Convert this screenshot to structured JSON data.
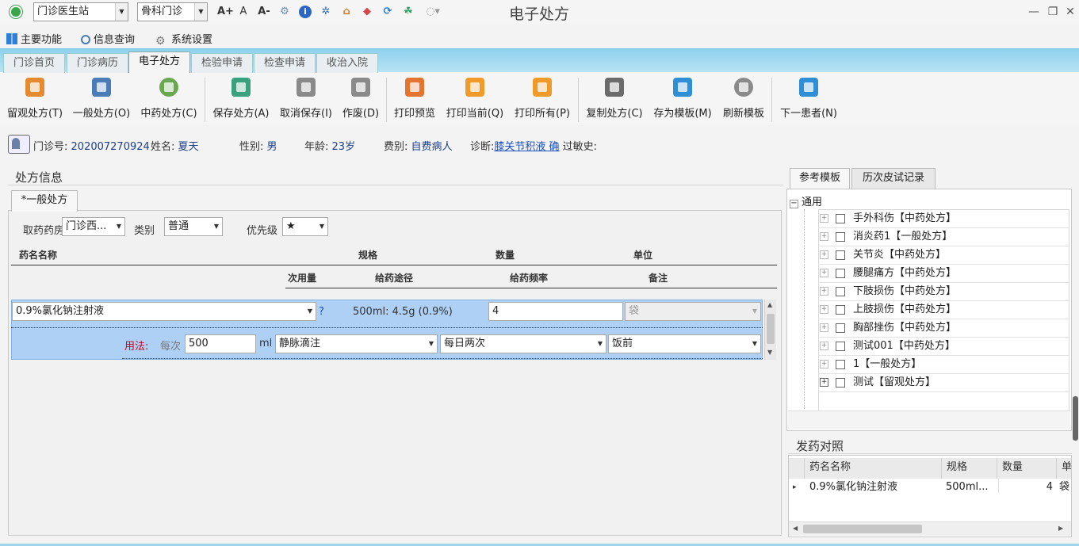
{
  "title_bar": {
    "station": "门诊医生站",
    "department": "骨科门诊",
    "window_title": "电子处方",
    "font_icons": [
      "A+",
      "A",
      "A-"
    ]
  },
  "menu": [
    "主要功能",
    "信息查询",
    "系统设置"
  ],
  "tabs": [
    "门诊首页",
    "门诊病历",
    "电子处方",
    "检验申请",
    "检查申请",
    "收治入院"
  ],
  "active_tab": "电子处方",
  "toolbar": [
    {
      "label": "留观处方(T)",
      "icon": "observation-rx-icon",
      "color": "#e58a2e"
    },
    {
      "label": "一般处方(O)",
      "icon": "general-rx-icon",
      "color": "#4a7db8"
    },
    {
      "label": "中药处方(C)",
      "icon": "herbal-rx-icon",
      "color": "#6aa84f"
    },
    {
      "label": "保存处方(A)",
      "icon": "save-icon",
      "color": "#3aa17e"
    },
    {
      "label": "取消保存(I)",
      "icon": "cancel-save-icon",
      "color": "#8a8a8a"
    },
    {
      "label": "作废(D)",
      "icon": "void-icon",
      "color": "#8a8a8a"
    },
    {
      "label": "打印预览",
      "icon": "print-preview-icon",
      "color": "#e5742e"
    },
    {
      "label": "打印当前(Q)",
      "icon": "print-current-icon",
      "color": "#f09a2a"
    },
    {
      "label": "打印所有(P)",
      "icon": "print-all-icon",
      "color": "#f09a2a"
    },
    {
      "label": "复制处方(C)",
      "icon": "copy-rx-icon",
      "color": "#6b6b6b"
    },
    {
      "label": "存为模板(M)",
      "icon": "save-template-icon",
      "color": "#2f8fd6"
    },
    {
      "label": "刷新模板",
      "icon": "refresh-icon",
      "color": "#8a8a8a"
    },
    {
      "label": "下一患者(N)",
      "icon": "next-patient-icon",
      "color": "#2f8fd6"
    }
  ],
  "patient": {
    "visit_no_label": "门诊号:",
    "visit_no": "202007270924",
    "name_label": "姓名:",
    "name": "夏天",
    "gender_label": "性别:",
    "gender": "男",
    "age_label": "年龄:",
    "age": "23岁",
    "fee_label": "费别:",
    "fee": "自费病人",
    "diagnosis_label": "诊断:",
    "diagnosis": "膝关节积液 确",
    "allergy_label": "过敏史:"
  },
  "rx_section_title": "处方信息",
  "rx_tab": "*一般处方",
  "rx_filters": {
    "pharmacy_label": "取药药房",
    "pharmacy": "门诊西...",
    "category_label": "类别",
    "category": "普通",
    "priority_label": "优先级",
    "priority": "★"
  },
  "rx_headers_top": [
    "药名名称",
    "规格",
    "数量",
    "单位"
  ],
  "rx_headers_bottom": [
    "次用量",
    "给药途径",
    "给药频率",
    "备注"
  ],
  "rx_item": {
    "drug": "0.9%氯化钠注射液",
    "question": "?",
    "spec": "500ml: 4.5g (0.9%)",
    "quantity": "4",
    "unit": "袋",
    "usage_label": "用法:",
    "per_label": "每次",
    "dose": "500",
    "dose_unit": "ml",
    "route": "静脉滴注",
    "frequency": "每日两次",
    "note": "饭前"
  },
  "right_tabs": [
    "参考模板",
    "历次皮试记录"
  ],
  "template_root": "通用",
  "templates": [
    "手外科伤【中药处方】",
    "消炎药1【一般处方】",
    "关节炎【中药处方】",
    "腰腿痛方【中药处方】",
    "下肢损伤【中药处方】",
    "上肢损伤【中药处方】",
    "胸部挫伤【中药处方】",
    "测试001【中药处方】",
    "1【一般处方】",
    "测试【留观处方】"
  ],
  "dispense_title": "发药对照",
  "dispense_headers": [
    "药名名称",
    "规格",
    "数量",
    "单"
  ],
  "dispense_row": {
    "drug": "0.9%氯化钠注射液",
    "spec": "500ml...",
    "qty": "4",
    "unit": "袋"
  },
  "colors": {
    "highlight": "#aed0f5",
    "tab_strip": "#a9dcf1",
    "diag_link": "#1a4fc4",
    "usage_red": "#d0021b"
  }
}
